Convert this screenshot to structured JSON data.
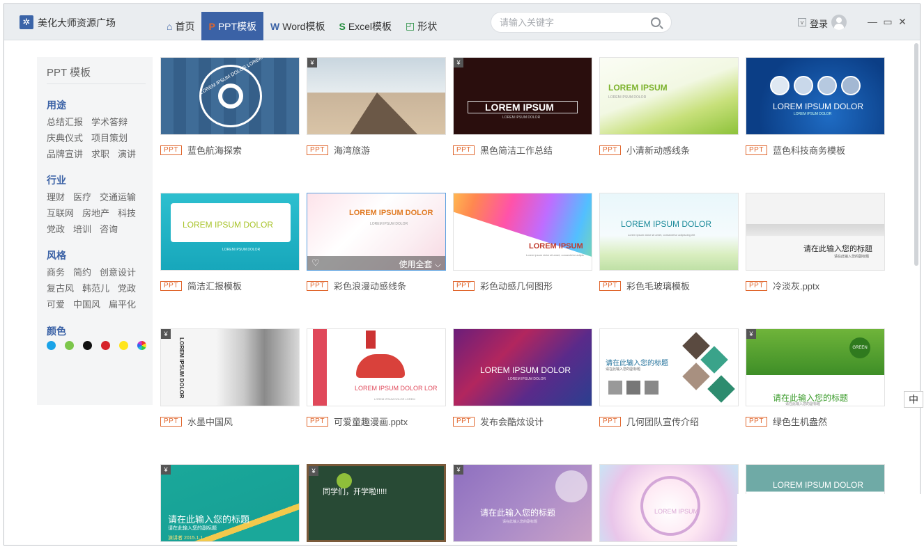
{
  "app": {
    "title": "美化大师资源广场"
  },
  "nav": {
    "tabs": [
      {
        "label": "首页"
      },
      {
        "label": "PPT模板"
      },
      {
        "label": "Word模板"
      },
      {
        "label": "Excel模板"
      },
      {
        "label": "形状"
      }
    ]
  },
  "search": {
    "placeholder": "请输入关键字"
  },
  "user": {
    "login_label": "登录"
  },
  "sidebar": {
    "title": "PPT 模板",
    "categories": [
      {
        "head": "用途",
        "rows": [
          [
            "总结汇报",
            "学术答辩"
          ],
          [
            "庆典仪式",
            "项目策划"
          ],
          [
            "品牌宣讲",
            "求职",
            "演讲"
          ]
        ]
      },
      {
        "head": "行业",
        "rows": [
          [
            "理财",
            "医疗",
            "交通运输"
          ],
          [
            "互联网",
            "房地产",
            "科技"
          ],
          [
            "党政",
            "培训",
            "咨询"
          ]
        ]
      },
      {
        "head": "风格",
        "rows": [
          [
            "商务",
            "简约",
            "创意设计"
          ],
          [
            "复古风",
            "韩范儿",
            "党政"
          ],
          [
            "可爱",
            "中国风",
            "扁平化"
          ]
        ]
      }
    ],
    "color_head": "颜色",
    "colors": [
      "#1aa3e8",
      "#7cc64b",
      "#111111",
      "#d6232a",
      "#ffe51a",
      "multi"
    ]
  },
  "badge": "PPT",
  "templates": [
    {
      "name": "蓝色航海探索",
      "thumb_text": "LOREM IPSUM DOLOR LOREM"
    },
    {
      "name": "海湾旅游",
      "thumb_text": ""
    },
    {
      "name": "黑色简洁工作总结",
      "thumb_text": "LOREM IPSUM",
      "thumb_sub": "LOREM IPSUM DOLOR"
    },
    {
      "name": "小清新动感线条",
      "thumb_text": "LOREM IPSUM",
      "thumb_sub": "LOREM IPSUM DOLOR"
    },
    {
      "name": "蓝色科技商务模板",
      "thumb_text": "LOREM IPSUM DOLOR",
      "thumb_sub": "LOREM IPSUM DOLOR"
    },
    {
      "name": "简洁汇报模板",
      "thumb_text": "LOREM IPSUM DOLOR",
      "thumb_sub": "LOREM IPSUM DOLOR"
    },
    {
      "name": "彩色浪漫动感线条",
      "thumb_text": "LOREM IPSUM DOLOR",
      "thumb_sub": "LOREM IPSUM DOLOR",
      "overlay": "使用全套"
    },
    {
      "name": "彩色动感几何图形",
      "thumb_text": "LOREM IPSUM",
      "thumb_sub": "Lorem ipsum dolor sit amet, consectetur adipis"
    },
    {
      "name": "彩色毛玻璃模板",
      "thumb_text": "LOREM IPSUM DOLOR",
      "thumb_sub": "Lorem ipsum dolor sit amet, consectetur adipiscing elit"
    },
    {
      "name": "冷淡灰.pptx",
      "thumb_text": "请在此输入您的标题",
      "thumb_sub": "请在此输入您的副标题"
    },
    {
      "name": "水墨中国风",
      "thumb_text": "LOREM IPSUM DOLOR"
    },
    {
      "name": "可爱童趣漫画.pptx",
      "thumb_text": "LOREM IPSUM DOLOR LOR",
      "thumb_sub": "LOREM IPSUM DOLOR LOREM"
    },
    {
      "name": "发布会酷炫设计",
      "thumb_text": "LOREM IPSUM DOLOR",
      "thumb_sub": "LOREM IPSUM DOLOR"
    },
    {
      "name": "几何团队宣传介绍",
      "thumb_text": "请在此输入您的标题",
      "thumb_sub": "请在此输入您的副标题"
    },
    {
      "name": "绿色生机盎然",
      "thumb_text": "请在此输入您的标题",
      "thumb_sub": "请在此输入您的副标题",
      "thumb_badge": "GREEN"
    },
    {
      "name": "",
      "thumb_text": "请在此输入您的标题",
      "thumb_sub": "请在此输入您的副标题",
      "thumb_meta": "演讲者  2015.1.1"
    },
    {
      "name": "",
      "thumb_text": "同学们，开学啦!!!!!"
    },
    {
      "name": "",
      "thumb_text": "请在此输入您的标题",
      "thumb_sub": "请在此输入您的副标题"
    },
    {
      "name": "",
      "thumb_text": "LOREM IPSUM"
    },
    {
      "name": "",
      "thumb_text": "LOREM IPSUM DOLOR"
    }
  ],
  "ime": "中",
  "yen": "¥"
}
